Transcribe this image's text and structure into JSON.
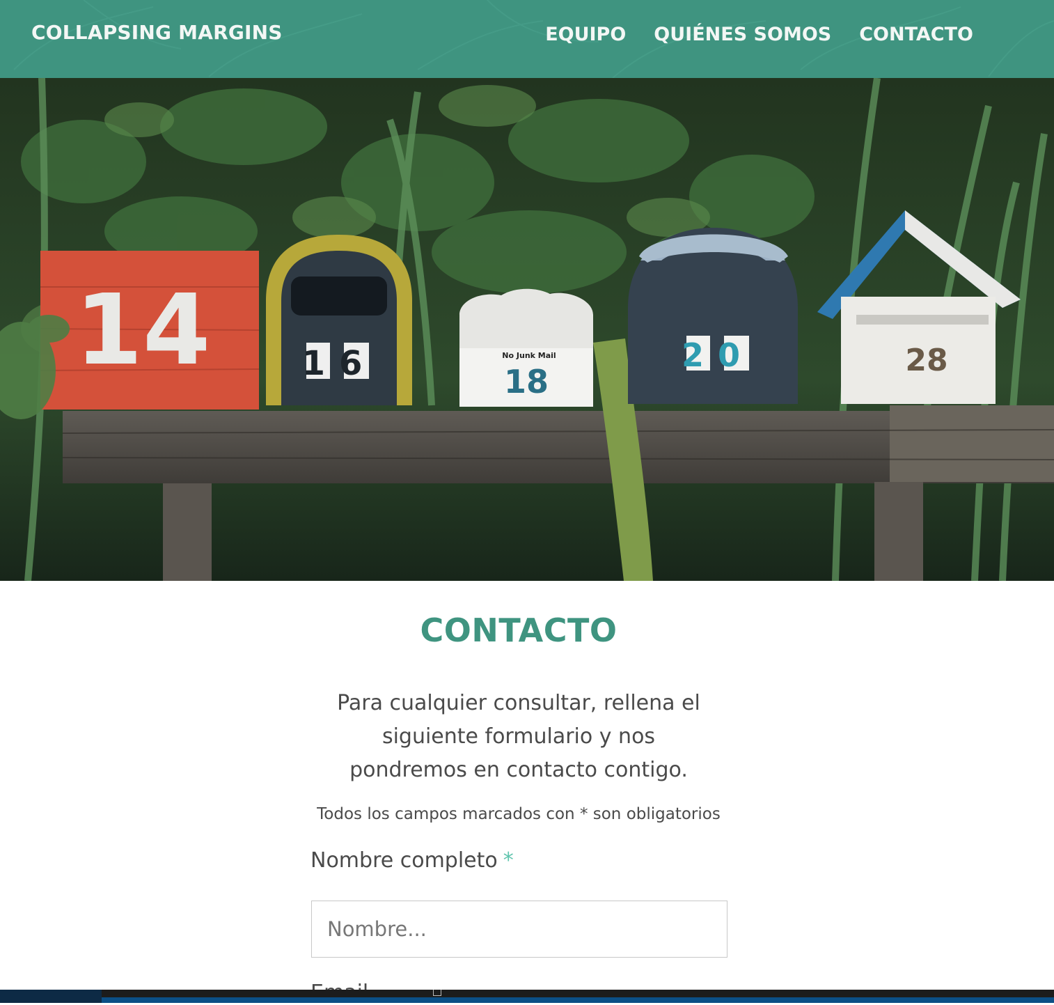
{
  "header": {
    "logo": "COLLAPSING MARGINS",
    "nav": [
      {
        "label": "EQUIPO"
      },
      {
        "label": "QUIÉNES SOMOS"
      },
      {
        "label": "CONTACTO"
      }
    ],
    "background_color": "#3f9480"
  },
  "hero": {
    "mailbox_numbers": [
      "14",
      "16",
      "18",
      "20",
      "28"
    ],
    "sticker_text": "No Junk Mail"
  },
  "main": {
    "title": "CONTACTO",
    "intro": "Para cualquier consultar, rellena el siguiente formulario y nos pondremos en contacto contigo.",
    "required_note": "Todos los campos marcados con * son obligatorios",
    "form": {
      "name_label": "Nombre completo",
      "required_mark": "*",
      "name_placeholder": "Nombre...",
      "email_label": "Email"
    }
  },
  "colors": {
    "accent": "#3f9480",
    "required": "#5ec4ad",
    "text": "#4a4a4a"
  }
}
